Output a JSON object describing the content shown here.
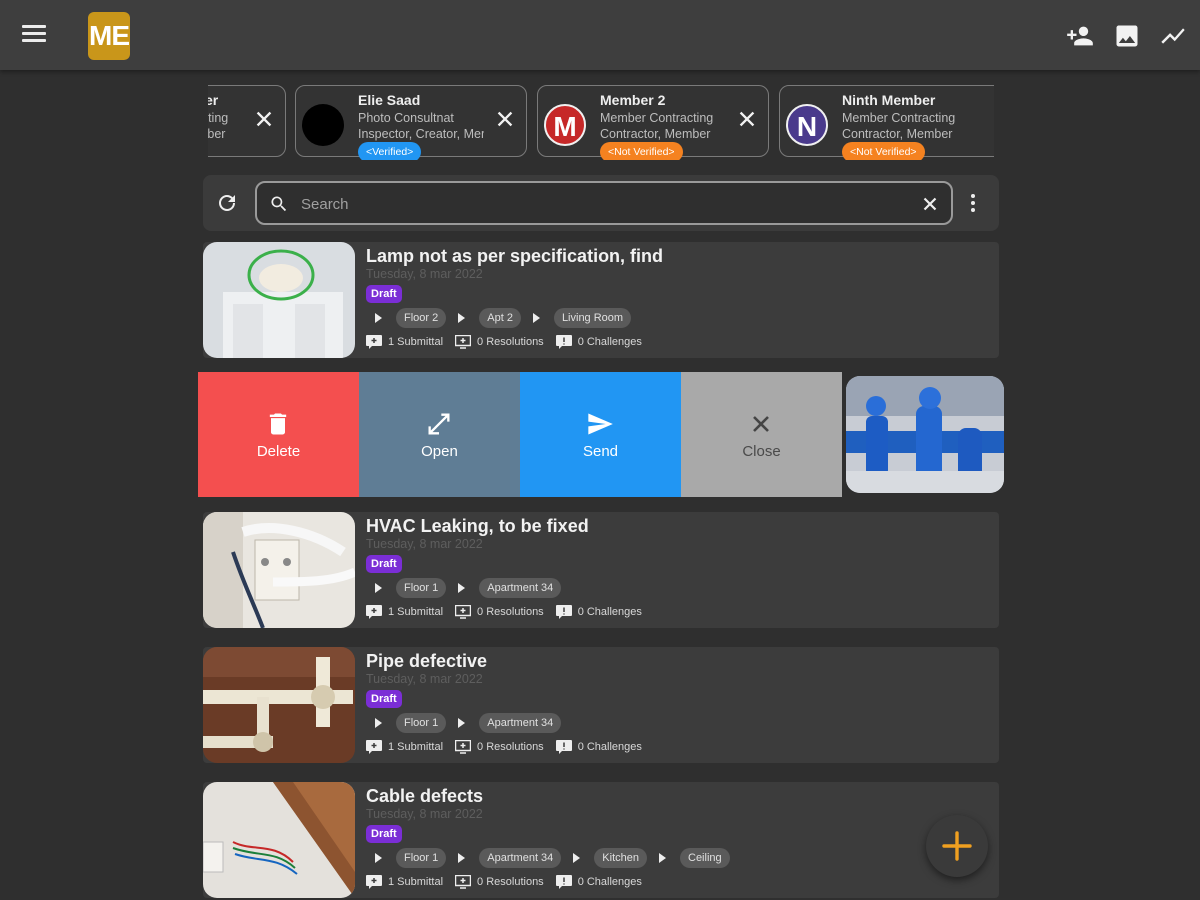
{
  "app": {
    "logo_text": "ME"
  },
  "toolbar": {
    "icons": [
      "add-person-icon",
      "image-icon",
      "trending-icon"
    ]
  },
  "members": [
    {
      "name": "",
      "role_line1": "Member Contracting",
      "role_line2": "Contractor, Member",
      "avatar_color": "#000000",
      "avatar_letter": ""
    },
    {
      "name": "Elie Saad",
      "role_line1": "Photo Consultnat",
      "role_line2": "Inspector, Creator, Member",
      "badge": "<Verified>",
      "badge_color": "#2196f3",
      "avatar_color": "#000000",
      "avatar_letter": ""
    },
    {
      "name": "Member 2",
      "role_line1": "Member Contracting",
      "role_line2": "Contractor, Member",
      "badge": "<Not Verified>",
      "badge_color": "#f58220",
      "avatar_color": "#c62828",
      "avatar_letter": "M"
    },
    {
      "name": "Ninth Member",
      "role_line1": "Member Contracting",
      "role_line2": "Contractor, Member",
      "badge": "<Not Verified>",
      "badge_color": "#f58220",
      "avatar_color": "#4a3a8c",
      "avatar_letter": "N"
    }
  ],
  "search": {
    "placeholder": "Search"
  },
  "issues": [
    {
      "title": "Lamp not as per specification, find",
      "date": "Tuesday, 8 mar 2022",
      "status": "Draft",
      "path": [
        "Floor 2",
        "Apt 2",
        "Living Room"
      ],
      "submittals": "1 Submittal",
      "resolutions": "0 Resolutions",
      "challenges": "0 Challenges"
    },
    {
      "title": "HVAC Leaking, to be fixed",
      "date": "Tuesday, 8 mar 2022",
      "status": "Draft",
      "path": [
        "Floor 1",
        "Apartment 34"
      ],
      "submittals": "1 Submittal",
      "resolutions": "0 Resolutions",
      "challenges": "0 Challenges"
    },
    {
      "title": "Pipe defective",
      "date": "Tuesday, 8 mar 2022",
      "status": "Draft",
      "path": [
        "Floor 1",
        "Apartment 34"
      ],
      "submittals": "1 Submittal",
      "resolutions": "0 Resolutions",
      "challenges": "0 Challenges"
    },
    {
      "title": "Cable defects",
      "date": "Tuesday, 8 mar 2022",
      "status": "Draft",
      "path": [
        "Floor 1",
        "Apartment 34",
        "Kitchen",
        "Ceiling"
      ],
      "submittals": "1 Submittal",
      "resolutions": "0 Resolutions",
      "challenges": "0 Challenges"
    }
  ],
  "swipe_actions": [
    {
      "label": "Delete",
      "color": "#f44f4f",
      "icon": "trash-icon"
    },
    {
      "label": "Open",
      "color": "#5f7d95",
      "icon": "expand-icon"
    },
    {
      "label": "Send",
      "color": "#2196f3",
      "icon": "send-icon"
    },
    {
      "label": "Close",
      "color": "#a9a9a9",
      "icon": "close-icon"
    }
  ],
  "fab": {
    "icon": "plus-icon",
    "color": "#f0a020"
  }
}
